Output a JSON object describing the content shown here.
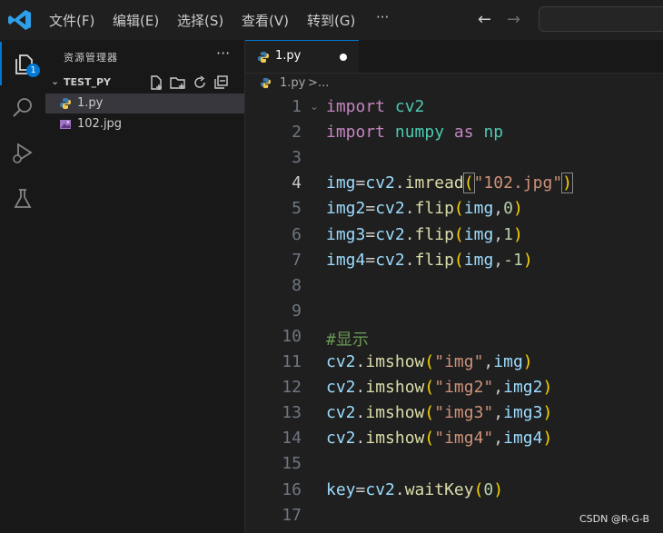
{
  "menu": {
    "items": [
      "文件(F)",
      "编辑(E)",
      "选择(S)",
      "查看(V)",
      "转到(G)"
    ],
    "more": "···"
  },
  "activity": {
    "explorer_badge": "1"
  },
  "sidebar": {
    "title": "资源管理器",
    "more": "···",
    "folder": "TEST_PY",
    "files": [
      {
        "name": "1.py",
        "icon": "python-file-icon",
        "selected": true
      },
      {
        "name": "102.jpg",
        "icon": "image-file-icon",
        "selected": false
      }
    ]
  },
  "tab": {
    "label": "1.py",
    "dirty": true
  },
  "breadcrumb": {
    "file": "1.py",
    "separator": ">",
    "more": "..."
  },
  "editor": {
    "active_line": 4,
    "lines": [
      "import cv2",
      "import numpy as np",
      "",
      "img=cv2.imread(\"102.jpg\")",
      "img2=cv2.flip(img,0)",
      "img3=cv2.flip(img,1)",
      "img4=cv2.flip(img,-1)",
      "",
      "",
      "#显示",
      "cv2.imshow(\"img\",img)",
      "cv2.imshow(\"img2\",img2)",
      "cv2.imshow(\"img3\",img3)",
      "cv2.imshow(\"img4\",img4)",
      "",
      "key=cv2.waitKey(0)",
      ""
    ]
  },
  "watermark": "CSDN @R-G-B",
  "colors": {
    "accent": "#0078d4",
    "keyword": "#c586c0",
    "module": "#4ec9b0",
    "variable": "#9cdcfe",
    "function": "#dcdcaa",
    "string": "#ce9178",
    "number": "#b5cea8",
    "comment": "#6a9955",
    "bracket": "#ffd700"
  }
}
